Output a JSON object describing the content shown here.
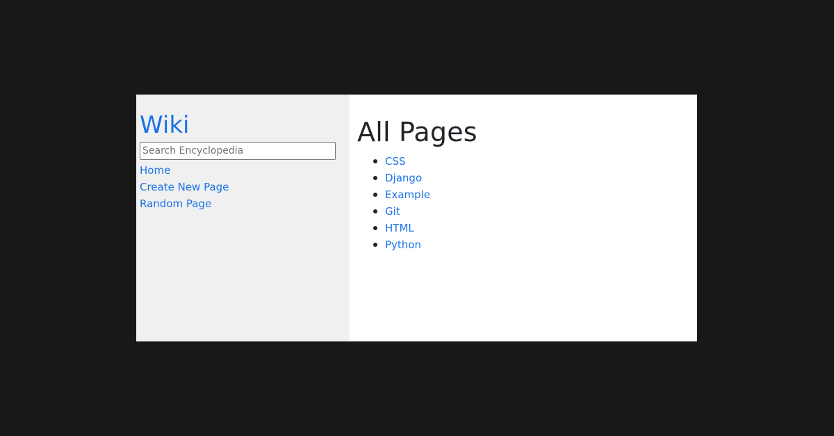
{
  "sidebar": {
    "brand": "Wiki",
    "search": {
      "placeholder": "Search Encyclopedia",
      "value": ""
    },
    "nav": [
      {
        "label": "Home"
      },
      {
        "label": "Create New Page"
      },
      {
        "label": "Random Page"
      }
    ]
  },
  "main": {
    "title": "All Pages",
    "pages": [
      {
        "label": "CSS"
      },
      {
        "label": "Django"
      },
      {
        "label": "Example"
      },
      {
        "label": "Git"
      },
      {
        "label": "HTML"
      },
      {
        "label": "Python"
      }
    ]
  },
  "colors": {
    "link": "#1a73e8",
    "sidebar_bg": "#f0f0f0",
    "page_bg": "#181818",
    "heading": "#212529"
  }
}
